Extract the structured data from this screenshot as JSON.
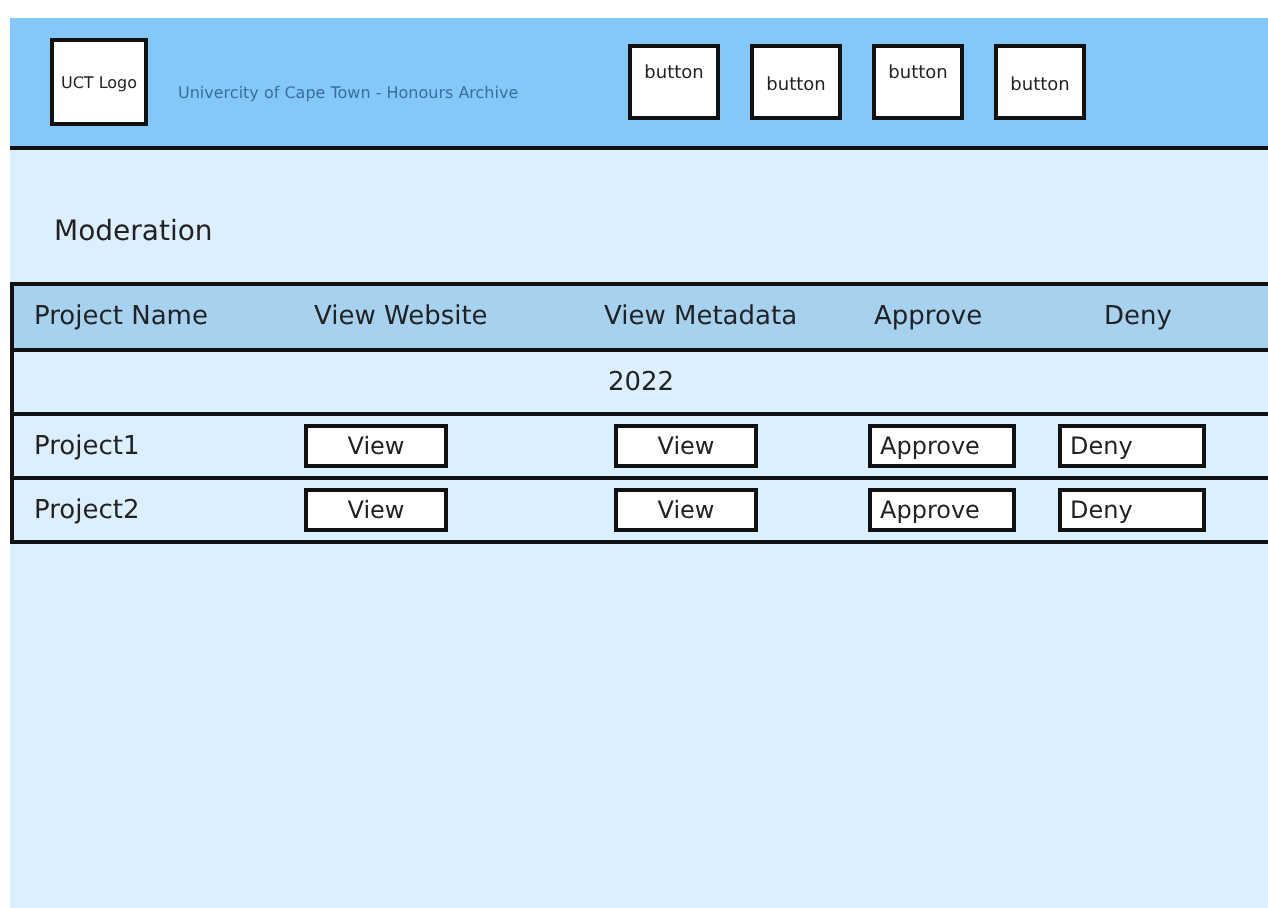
{
  "header": {
    "logo": "UCT Logo",
    "site_title": "Univercity of Cape Town - Honours Archive",
    "buttons": [
      "button",
      "button",
      "button",
      "button"
    ]
  },
  "page_title": "Moderation",
  "table": {
    "columns": [
      "Project Name",
      "View Website",
      "View Metadata",
      "Approve",
      "Deny"
    ],
    "groups": [
      {
        "label": "2022",
        "rows": [
          {
            "name": "Project1",
            "website": "View",
            "metadata": "View",
            "approve": "Approve",
            "deny": "Deny"
          },
          {
            "name": "Project2",
            "website": "View",
            "metadata": "View",
            "approve": "Approve",
            "deny": "Deny"
          }
        ]
      }
    ]
  }
}
